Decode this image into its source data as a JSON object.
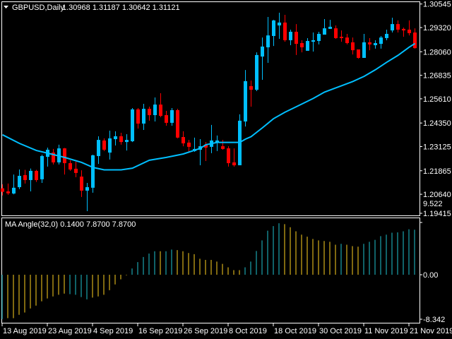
{
  "header": {
    "symbol_label": "GBPUSD,Daily",
    "ohlc_values": "1.30968 1.31187 1.30642 1.31121"
  },
  "indicator": {
    "label": "MA Angle(32,0) 0.1400 7.8700 7.8700"
  },
  "colors": {
    "background": "#000000",
    "bull": "#00BFFF",
    "bear": "#FF0000",
    "ma": "#00BFFF",
    "hist_up": "#20C5D0",
    "hist_down": "#FFD21F",
    "frame": "#FFFFFF"
  },
  "chart_data": [
    {
      "type": "candlestick",
      "title": "GBPUSD,Daily",
      "ylim": [
        1.19415,
        1.30545
      ],
      "y_ticks": [
        "1.30545",
        "1.29320",
        "1.28060",
        "1.26835",
        "1.25610",
        "1.24350",
        "1.23125",
        "1.21865",
        "1.20640",
        "1.19415"
      ],
      "x_ticks": [
        {
          "label": "13 Aug 2019",
          "index": 0
        },
        {
          "label": "23 Aug 2019",
          "index": 8
        },
        {
          "label": "4 Sep 2019",
          "index": 16
        },
        {
          "label": "16 Sep 2019",
          "index": 24
        },
        {
          "label": "26 Sep 2019",
          "index": 32
        },
        {
          "label": "8 Oct 2019",
          "index": 40
        },
        {
          "label": "18 Oct 2019",
          "index": 48
        },
        {
          "label": "30 Oct 2019",
          "index": 56
        },
        {
          "label": "11 Nov 2019",
          "index": 64
        },
        {
          "label": "21 Nov 2019",
          "index": 72
        }
      ],
      "ohlc": [
        [
          1.2095,
          1.2116,
          1.2058,
          1.2077
        ],
        [
          1.2079,
          1.212,
          1.2061,
          1.2069
        ],
        [
          1.2068,
          1.2167,
          1.2064,
          1.2098
        ],
        [
          1.2101,
          1.2193,
          1.2091,
          1.216
        ],
        [
          1.2164,
          1.2191,
          1.212,
          1.2138
        ],
        [
          1.2138,
          1.2198,
          1.2079,
          1.2186
        ],
        [
          1.2186,
          1.2191,
          1.2128,
          1.2138
        ],
        [
          1.2142,
          1.227,
          1.2123,
          1.2263
        ],
        [
          1.2259,
          1.2307,
          1.2208,
          1.2296
        ],
        [
          1.2281,
          1.23,
          1.2219,
          1.223
        ],
        [
          1.223,
          1.2322,
          1.2219,
          1.2303
        ],
        [
          1.2303,
          1.2305,
          1.2167,
          1.2226
        ],
        [
          1.2226,
          1.2241,
          1.2186,
          1.2193
        ],
        [
          1.2197,
          1.2234,
          1.2153,
          1.2175
        ],
        [
          1.2156,
          1.2189,
          1.205,
          1.2083
        ],
        [
          1.2083,
          1.2123,
          1.1976,
          1.2101
        ],
        [
          1.2098,
          1.227,
          1.2072,
          1.2267
        ],
        [
          1.2263,
          1.2366,
          1.2222,
          1.2347
        ],
        [
          1.2344,
          1.2355,
          1.2289,
          1.2296
        ],
        [
          1.2281,
          1.2395,
          1.2245,
          1.2355
        ],
        [
          1.2351,
          1.2392,
          1.2318,
          1.2366
        ],
        [
          1.2366,
          1.2384,
          1.2322,
          1.2336
        ],
        [
          1.2336,
          1.2377,
          1.2292,
          1.2347
        ],
        [
          1.234,
          1.2513,
          1.2336,
          1.2506
        ],
        [
          1.2506,
          1.2513,
          1.2406,
          1.2432
        ],
        [
          1.2432,
          1.2535,
          1.2399,
          1.2509
        ],
        [
          1.2509,
          1.252,
          1.2447,
          1.2476
        ],
        [
          1.2476,
          1.2568,
          1.2443,
          1.2531
        ],
        [
          1.2531,
          1.259,
          1.2465,
          1.2472
        ],
        [
          1.2476,
          1.2498,
          1.2421,
          1.2436
        ],
        [
          1.2436,
          1.2513,
          1.2421,
          1.2502
        ],
        [
          1.2502,
          1.2509,
          1.2355,
          1.2359
        ],
        [
          1.2362,
          1.2392,
          1.2314,
          1.2329
        ],
        [
          1.2333,
          1.2347,
          1.2281,
          1.2311
        ],
        [
          1.2289,
          1.2359,
          1.2285,
          1.23
        ],
        [
          1.2296,
          1.2351,
          1.2215,
          1.2314
        ],
        [
          1.2322,
          1.2336,
          1.2237,
          1.2307
        ],
        [
          1.2311,
          1.2425,
          1.2278,
          1.2344
        ],
        [
          1.2336,
          1.237,
          1.2289,
          1.2344
        ],
        [
          1.2314,
          1.2347,
          1.2296,
          1.23
        ],
        [
          1.2303,
          1.2314,
          1.2208,
          1.2226
        ],
        [
          1.223,
          1.2303,
          1.2208,
          1.2215
        ],
        [
          1.2215,
          1.248,
          1.2215,
          1.2447
        ],
        [
          1.2443,
          1.2711,
          1.2417,
          1.2653
        ],
        [
          1.2627,
          1.2656,
          1.252,
          1.2608
        ],
        [
          1.2608,
          1.2803,
          1.2601,
          1.2789
        ],
        [
          1.2781,
          1.288,
          1.266,
          1.2833
        ],
        [
          1.2829,
          1.2987,
          1.2748,
          1.2891
        ],
        [
          1.2888,
          1.2972,
          1.2836,
          1.2969
        ],
        [
          1.2943,
          1.3009,
          1.2873,
          1.2958
        ],
        [
          1.2958,
          1.2998,
          1.2858,
          1.2866
        ],
        [
          1.2866,
          1.2921,
          1.284,
          1.291
        ],
        [
          1.291,
          1.295,
          1.2789,
          1.2847
        ],
        [
          1.2851,
          1.2866,
          1.2803,
          1.2829
        ],
        [
          1.2811,
          1.2877,
          1.2811,
          1.2862
        ],
        [
          1.2858,
          1.2906,
          1.2807,
          1.2866
        ],
        [
          1.2862,
          1.291,
          1.2844,
          1.2899
        ],
        [
          1.2895,
          1.2976,
          1.2895,
          1.2928
        ],
        [
          1.2925,
          1.2972,
          1.2925,
          1.2936
        ],
        [
          1.2928,
          1.2943,
          1.2873,
          1.2877
        ],
        [
          1.2884,
          1.2917,
          1.2858,
          1.2877
        ],
        [
          1.288,
          1.2899,
          1.2844,
          1.2851
        ],
        [
          1.2855,
          1.288,
          1.2792,
          1.2814
        ],
        [
          1.2818,
          1.2818,
          1.277,
          1.2774
        ],
        [
          1.2774,
          1.2899,
          1.2774,
          1.2855
        ],
        [
          1.2855,
          1.2877,
          1.2814,
          1.2844
        ],
        [
          1.284,
          1.2866,
          1.2822,
          1.2851
        ],
        [
          1.2847,
          1.2888,
          1.2822,
          1.288
        ],
        [
          1.2877,
          1.2921,
          1.2866,
          1.2899
        ],
        [
          1.2917,
          1.2983,
          1.2906,
          1.295
        ],
        [
          1.295,
          1.2969,
          1.2906,
          1.2921
        ],
        [
          1.2925,
          1.2932,
          1.2884,
          1.2917
        ],
        [
          1.2921,
          1.2969,
          1.2891,
          1.2903
        ],
        [
          1.2906,
          1.2928,
          1.2822,
          1.2825
        ]
      ],
      "ma_points": [
        [
          0,
          1.2374
        ],
        [
          3,
          1.2329
        ],
        [
          6,
          1.2292
        ],
        [
          8,
          1.2278
        ],
        [
          11,
          1.2256
        ],
        [
          14,
          1.223
        ],
        [
          16,
          1.2204
        ],
        [
          18,
          1.2191
        ],
        [
          21,
          1.2191
        ],
        [
          23,
          1.22
        ],
        [
          26,
          1.2241
        ],
        [
          29,
          1.2256
        ],
        [
          32,
          1.2274
        ],
        [
          35,
          1.2303
        ],
        [
          36,
          1.2322
        ],
        [
          38,
          1.2334
        ],
        [
          42,
          1.2334
        ],
        [
          43,
          1.2351
        ],
        [
          44,
          1.2364
        ],
        [
          46,
          1.241
        ],
        [
          48,
          1.2458
        ],
        [
          50,
          1.2491
        ],
        [
          52,
          1.252
        ],
        [
          55,
          1.2563
        ],
        [
          57,
          1.2596
        ],
        [
          60,
          1.2629
        ],
        [
          62,
          1.2651
        ],
        [
          64,
          1.2678
        ],
        [
          66,
          1.2712
        ],
        [
          68,
          1.2751
        ],
        [
          70,
          1.2787
        ],
        [
          72,
          1.283
        ],
        [
          73,
          1.2849
        ]
      ]
    },
    {
      "type": "bar",
      "title": "MA Angle(32,0)",
      "ylim": [
        -8.342,
        9.522
      ],
      "y_ticks": [
        "9.522",
        "0.00",
        "-8.342"
      ],
      "values": [
        -7.74,
        -7.6,
        -7.6,
        -7.0,
        -6.6,
        -5.9,
        -5.4,
        -4.65,
        -4.15,
        -3.8,
        -3.5,
        -3.3,
        -3.4,
        -3.5,
        -3.9,
        -4.3,
        -4.0,
        -3.8,
        -3.5,
        -2.7,
        -1.7,
        -0.8,
        -0.1,
        1.1,
        2.2,
        3.1,
        3.7,
        4.1,
        4.1,
        4.1,
        4.4,
        4.3,
        4.1,
        3.8,
        3.6,
        2.8,
        2.6,
        2.6,
        2.3,
        1.9,
        1.3,
        0.8,
        0.8,
        1.3,
        2.3,
        4.15,
        6.0,
        7.7,
        8.5,
        9.0,
        8.85,
        8.3,
        7.6,
        7.0,
        6.65,
        6.25,
        6.0,
        5.9,
        5.75,
        5.25,
        5.4,
        5.25,
        5.0,
        4.9,
        5.4,
        5.75,
        6.1,
        6.75,
        7.0,
        7.35,
        7.4,
        7.6,
        7.95,
        7.87
      ],
      "rising": [
        true,
        false,
        false,
        false,
        false,
        false,
        false,
        false,
        false,
        false,
        false,
        false,
        true,
        true,
        true,
        true,
        false,
        false,
        false,
        false,
        false,
        false,
        false,
        true,
        true,
        true,
        true,
        true,
        false,
        true,
        true,
        false,
        false,
        false,
        false,
        false,
        false,
        false,
        false,
        false,
        false,
        false,
        false,
        true,
        true,
        true,
        true,
        true,
        true,
        true,
        false,
        false,
        false,
        false,
        false,
        false,
        false,
        false,
        false,
        false,
        true,
        false,
        false,
        false,
        true,
        true,
        true,
        true,
        true,
        true,
        true,
        true,
        true,
        true
      ]
    }
  ]
}
